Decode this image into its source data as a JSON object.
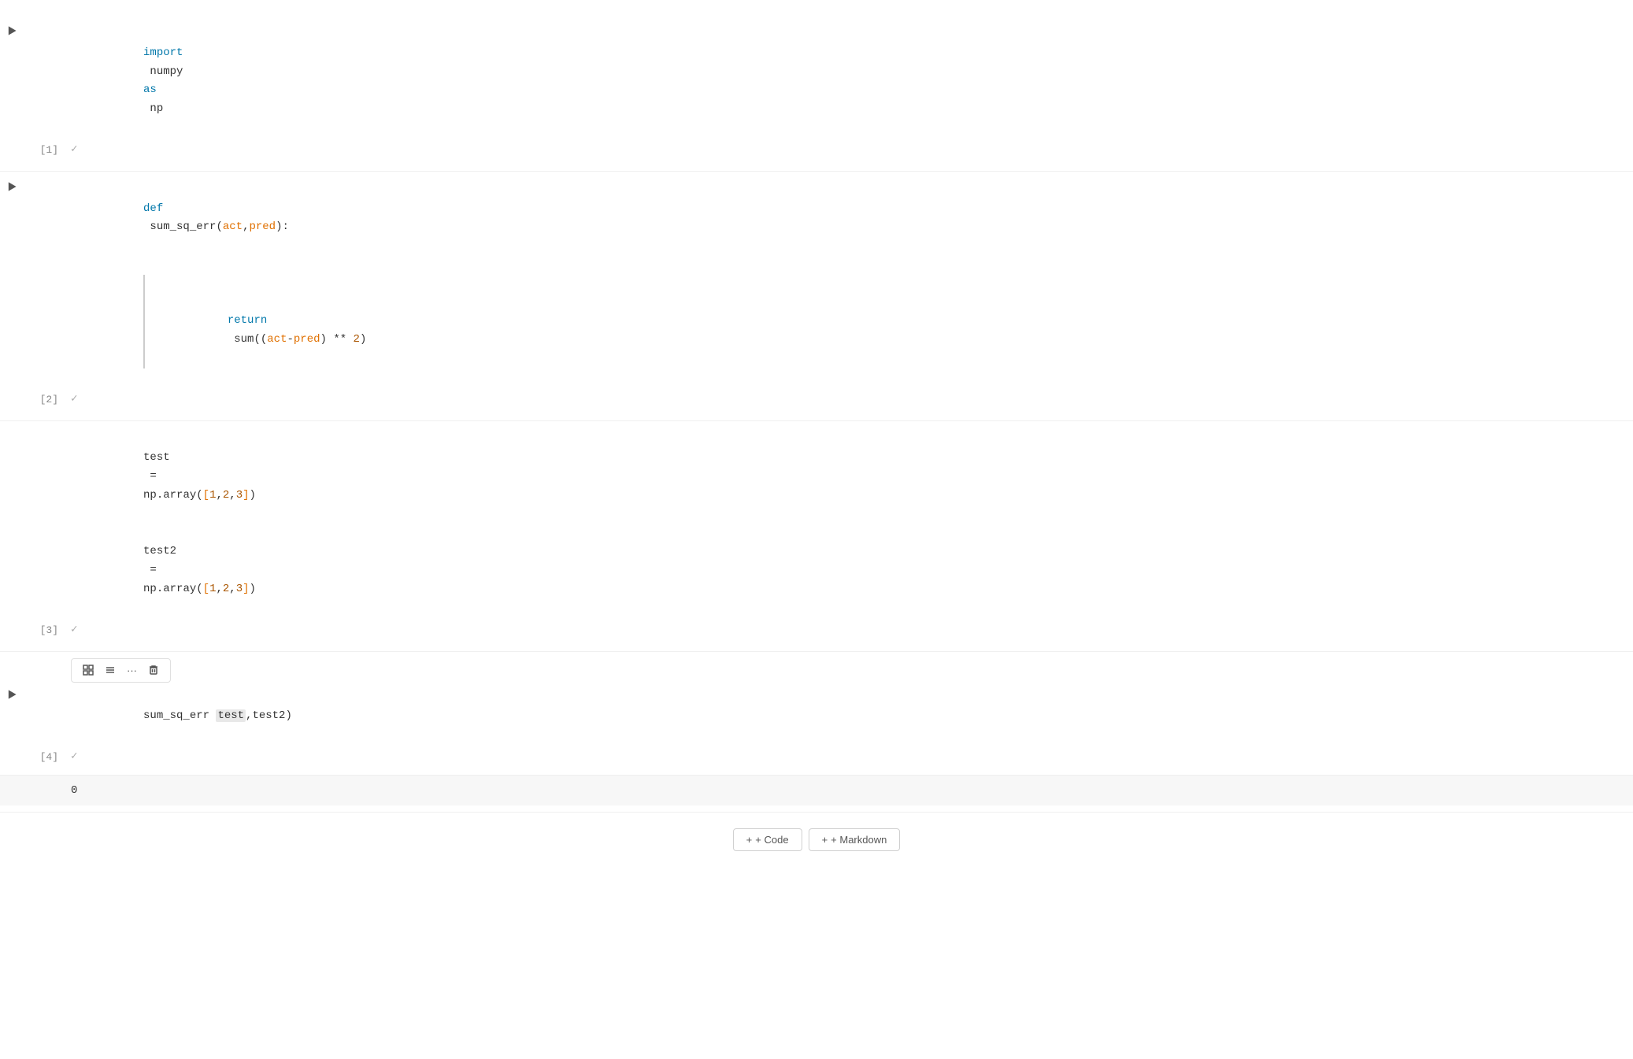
{
  "notebook": {
    "cells": [
      {
        "id": "cell-1",
        "number": "[1]",
        "type": "code",
        "status": "executed",
        "lines": [
          "import numpy as np"
        ],
        "output": null
      },
      {
        "id": "cell-2",
        "number": "[2]",
        "type": "code",
        "status": "executed",
        "lines": [
          "def sum_sq_err(act,pred):",
          "    return sum((act-pred) ** 2)"
        ],
        "output": null
      },
      {
        "id": "cell-3",
        "number": "[3]",
        "type": "code",
        "status": "executed",
        "lines": [
          "test = np.array([1,2,3])",
          "test2 = np.array([1,2,3])"
        ],
        "output": null
      },
      {
        "id": "cell-4",
        "number": "[4]",
        "type": "code",
        "status": "executed",
        "lines": [
          "sum_sq_err(test,test2)"
        ],
        "output": "0",
        "has_toolbar": true
      }
    ],
    "toolbar": {
      "grid_btn": "⊞",
      "list_btn": "≡",
      "more_btn": "···",
      "delete_btn": "🗑"
    },
    "add_buttons": {
      "code_label": "+ Code",
      "markdown_label": "+ Markdown"
    }
  }
}
